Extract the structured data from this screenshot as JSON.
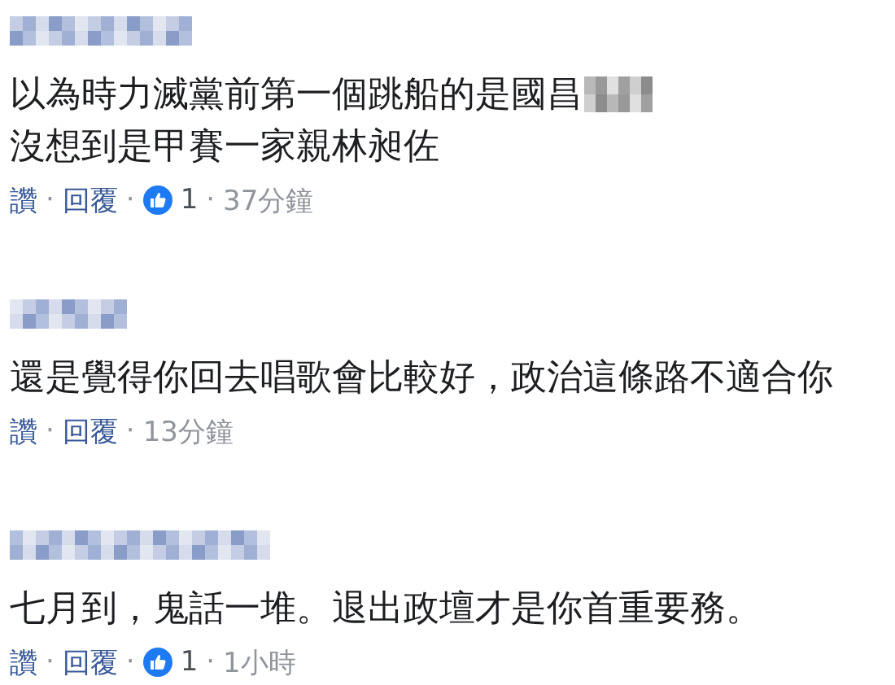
{
  "comments": [
    {
      "author_blurred": true,
      "lines": [
        {
          "text": "以為時力滅黨前第一個跳船的是國昌",
          "redacted_tail": true
        },
        {
          "text": "沒想到是甲賽一家親林昶佐",
          "redacted_tail": false
        }
      ],
      "actions": [
        {
          "kind": "link",
          "text": "讚"
        },
        {
          "kind": "separator",
          "text": "·"
        },
        {
          "kind": "link",
          "text": "回覆"
        },
        {
          "kind": "separator",
          "text": "·"
        },
        {
          "kind": "reaction",
          "text": "1"
        },
        {
          "kind": "separator",
          "text": "·"
        },
        {
          "kind": "time",
          "text": "37分鐘"
        }
      ]
    },
    {
      "author_blurred": true,
      "lines": [
        {
          "text": "還是覺得你回去唱歌會比較好，政治這條路不適合你",
          "redacted_tail": false
        }
      ],
      "actions": [
        {
          "kind": "link",
          "text": "讚"
        },
        {
          "kind": "separator",
          "text": "·"
        },
        {
          "kind": "link",
          "text": "回覆"
        },
        {
          "kind": "separator",
          "text": "·"
        },
        {
          "kind": "time",
          "text": "13分鐘"
        }
      ]
    },
    {
      "author_blurred": true,
      "lines": [
        {
          "text": "七月到，鬼話一堆。退出政壇才是你首重要務。",
          "redacted_tail": false
        }
      ],
      "actions": [
        {
          "kind": "link",
          "text": "讚"
        },
        {
          "kind": "separator",
          "text": "·"
        },
        {
          "kind": "link",
          "text": "回覆"
        },
        {
          "kind": "separator",
          "text": "·"
        },
        {
          "kind": "reaction",
          "text": "1"
        },
        {
          "kind": "separator",
          "text": "·"
        },
        {
          "kind": "time",
          "text": "1小時"
        }
      ]
    }
  ]
}
